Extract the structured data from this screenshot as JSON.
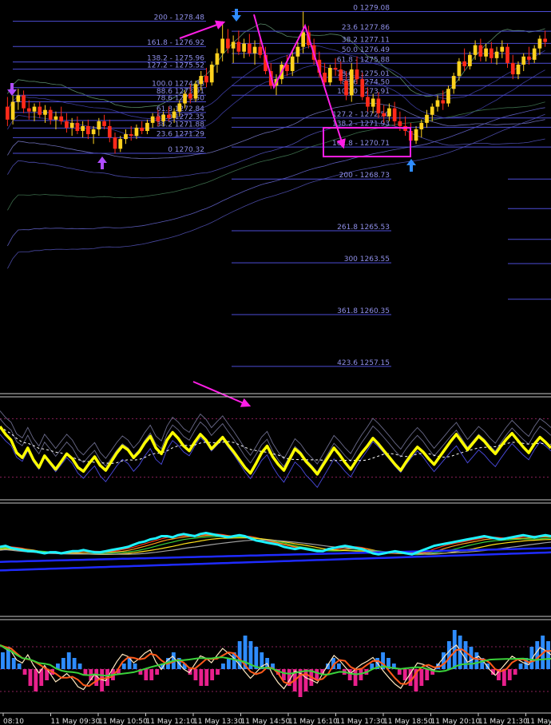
{
  "colors": {
    "background": "#000000",
    "bull": "#ffd21e",
    "bear": "#ff2a1a",
    "fib_line": "#4d4dd6",
    "fib_text": "#8f8fe8",
    "annotation": "#ff1ee6",
    "blue_arrow": "#2f8cff",
    "purple_arrow": "#b04cff",
    "oscillator": "#ffff00",
    "cyan_line": "#1ef2ff",
    "blue_ma": "#1f2bff",
    "hist_up": "#2e8cff",
    "hist_down": "#e8208c",
    "separator": "#c8c8c8",
    "axis_text": "#e0e0e0"
  },
  "chart_data": [
    {
      "type": "candlestick",
      "panel": "price",
      "fib_levels_left": [
        {
          "label": "200 - 1278.48"
        },
        {
          "label": "161.8 - 1276.92"
        },
        {
          "label": "138.2 - 1275.96"
        },
        {
          "label": "127.2 - 1275.52"
        },
        {
          "label": "100.0 1274.38"
        },
        {
          "label": "88.6 1273.91"
        },
        {
          "label": "78.6 1273.50"
        },
        {
          "label": "61.8 1272.84"
        },
        {
          "label": "50.0 1272.35"
        },
        {
          "label": "38.2 1271.88"
        },
        {
          "label": "23.6 1271.29"
        },
        {
          "label": "0 1270.32"
        }
      ],
      "fib_levels_right": [
        {
          "label": "0 1279.08"
        },
        {
          "label": "23.6 1277.86"
        },
        {
          "label": "38.2 1277.11"
        },
        {
          "label": "50.0 1276.49"
        },
        {
          "label": "61.8 - 1275.88"
        },
        {
          "label": "78.6 - 1275.01"
        },
        {
          "label": "88.6 1274.50"
        },
        {
          "label": "100.0 1273.91"
        },
        {
          "label": "127.2 - 1272.50"
        },
        {
          "label": "138.2 - 1271.93"
        },
        {
          "label": "161.8 - 1270.71"
        }
      ],
      "fib_extensions": [
        {
          "label": "200 - 1268.73"
        },
        {
          "label": "261.8 1265.53"
        },
        {
          "label": "300 1263.55"
        },
        {
          "label": "361.8 1260.35"
        },
        {
          "label": "423.6 1257.15"
        }
      ],
      "ohlc": [
        {
          "o": 1273.2,
          "h": 1273.8,
          "l": 1272.0,
          "c": 1272.4
        },
        {
          "o": 1272.4,
          "h": 1273.9,
          "l": 1272.1,
          "c": 1273.5
        },
        {
          "o": 1273.5,
          "h": 1274.3,
          "l": 1273.0,
          "c": 1273.9
        },
        {
          "o": 1273.9,
          "h": 1274.2,
          "l": 1272.8,
          "c": 1273.1
        },
        {
          "o": 1273.1,
          "h": 1273.6,
          "l": 1272.4,
          "c": 1272.9
        },
        {
          "o": 1272.9,
          "h": 1273.4,
          "l": 1272.3,
          "c": 1273.2
        },
        {
          "o": 1273.2,
          "h": 1273.5,
          "l": 1272.5,
          "c": 1272.7
        },
        {
          "o": 1272.7,
          "h": 1273.3,
          "l": 1272.2,
          "c": 1273.0
        },
        {
          "o": 1273.0,
          "h": 1273.2,
          "l": 1272.1,
          "c": 1272.4
        },
        {
          "o": 1272.4,
          "h": 1272.9,
          "l": 1271.8,
          "c": 1272.6
        },
        {
          "o": 1272.6,
          "h": 1273.2,
          "l": 1272.1,
          "c": 1272.3
        },
        {
          "o": 1272.3,
          "h": 1272.8,
          "l": 1271.6,
          "c": 1271.9
        },
        {
          "o": 1271.9,
          "h": 1272.5,
          "l": 1271.4,
          "c": 1272.2
        },
        {
          "o": 1272.2,
          "h": 1272.6,
          "l": 1271.5,
          "c": 1271.7
        },
        {
          "o": 1271.7,
          "h": 1272.3,
          "l": 1271.3,
          "c": 1272.0
        },
        {
          "o": 1272.0,
          "h": 1272.4,
          "l": 1271.2,
          "c": 1271.5
        },
        {
          "o": 1271.5,
          "h": 1272.0,
          "l": 1270.9,
          "c": 1271.8
        },
        {
          "o": 1271.8,
          "h": 1272.5,
          "l": 1271.4,
          "c": 1272.3
        },
        {
          "o": 1272.3,
          "h": 1272.7,
          "l": 1271.8,
          "c": 1272.0
        },
        {
          "o": 1272.0,
          "h": 1272.4,
          "l": 1271.0,
          "c": 1271.3
        },
        {
          "o": 1271.3,
          "h": 1271.6,
          "l": 1270.3,
          "c": 1270.6
        },
        {
          "o": 1270.6,
          "h": 1271.4,
          "l": 1270.4,
          "c": 1271.2
        },
        {
          "o": 1271.2,
          "h": 1271.8,
          "l": 1270.9,
          "c": 1271.5
        },
        {
          "o": 1271.5,
          "h": 1272.0,
          "l": 1271.1,
          "c": 1271.4
        },
        {
          "o": 1271.4,
          "h": 1272.1,
          "l": 1271.2,
          "c": 1271.9
        },
        {
          "o": 1271.9,
          "h": 1272.3,
          "l": 1271.5,
          "c": 1271.7
        },
        {
          "o": 1271.7,
          "h": 1272.4,
          "l": 1271.5,
          "c": 1272.2
        },
        {
          "o": 1272.2,
          "h": 1272.8,
          "l": 1271.9,
          "c": 1272.6
        },
        {
          "o": 1272.6,
          "h": 1273.0,
          "l": 1272.0,
          "c": 1272.3
        },
        {
          "o": 1272.3,
          "h": 1272.9,
          "l": 1272.0,
          "c": 1272.7
        },
        {
          "o": 1272.7,
          "h": 1273.2,
          "l": 1272.3,
          "c": 1272.5
        },
        {
          "o": 1272.5,
          "h": 1273.1,
          "l": 1272.2,
          "c": 1272.9
        },
        {
          "o": 1272.9,
          "h": 1273.6,
          "l": 1272.6,
          "c": 1273.4
        },
        {
          "o": 1273.4,
          "h": 1274.2,
          "l": 1273.1,
          "c": 1274.0
        },
        {
          "o": 1274.0,
          "h": 1274.6,
          "l": 1273.4,
          "c": 1273.7
        },
        {
          "o": 1273.7,
          "h": 1274.8,
          "l": 1273.5,
          "c": 1274.6
        },
        {
          "o": 1274.6,
          "h": 1275.4,
          "l": 1274.2,
          "c": 1275.1
        },
        {
          "o": 1275.1,
          "h": 1275.6,
          "l": 1274.4,
          "c": 1274.7
        },
        {
          "o": 1274.7,
          "h": 1276.0,
          "l": 1274.5,
          "c": 1275.8
        },
        {
          "o": 1275.8,
          "h": 1276.8,
          "l": 1275.3,
          "c": 1276.5
        },
        {
          "o": 1276.5,
          "h": 1278.48,
          "l": 1276.0,
          "c": 1277.4
        },
        {
          "o": 1277.4,
          "h": 1278.0,
          "l": 1276.5,
          "c": 1276.8
        },
        {
          "o": 1276.8,
          "h": 1277.6,
          "l": 1275.9,
          "c": 1277.2
        },
        {
          "o": 1277.2,
          "h": 1277.9,
          "l": 1276.4,
          "c": 1276.6
        },
        {
          "o": 1276.6,
          "h": 1277.4,
          "l": 1276.2,
          "c": 1277.1
        },
        {
          "o": 1277.1,
          "h": 1277.7,
          "l": 1276.3,
          "c": 1276.5
        },
        {
          "o": 1276.5,
          "h": 1277.3,
          "l": 1275.8,
          "c": 1276.9
        },
        {
          "o": 1276.9,
          "h": 1277.5,
          "l": 1276.2,
          "c": 1276.4
        },
        {
          "o": 1276.4,
          "h": 1276.9,
          "l": 1275.2,
          "c": 1275.4
        },
        {
          "o": 1275.4,
          "h": 1275.9,
          "l": 1274.3,
          "c": 1274.5
        },
        {
          "o": 1274.5,
          "h": 1275.2,
          "l": 1273.91,
          "c": 1274.9
        },
        {
          "o": 1274.9,
          "h": 1276.0,
          "l": 1274.6,
          "c": 1275.8
        },
        {
          "o": 1275.8,
          "h": 1276.4,
          "l": 1275.1,
          "c": 1275.4
        },
        {
          "o": 1275.4,
          "h": 1276.6,
          "l": 1275.1,
          "c": 1276.3
        },
        {
          "o": 1276.3,
          "h": 1277.2,
          "l": 1275.9,
          "c": 1276.9
        },
        {
          "o": 1276.9,
          "h": 1279.08,
          "l": 1276.5,
          "c": 1277.8
        },
        {
          "o": 1277.8,
          "h": 1278.2,
          "l": 1276.8,
          "c": 1277.0
        },
        {
          "o": 1277.0,
          "h": 1277.4,
          "l": 1275.8,
          "c": 1276.1
        },
        {
          "o": 1276.1,
          "h": 1276.6,
          "l": 1275.0,
          "c": 1275.3
        },
        {
          "o": 1275.3,
          "h": 1275.9,
          "l": 1274.4,
          "c": 1274.7
        },
        {
          "o": 1274.7,
          "h": 1275.8,
          "l": 1274.5,
          "c": 1275.6
        },
        {
          "o": 1275.6,
          "h": 1276.2,
          "l": 1275.1,
          "c": 1275.5
        },
        {
          "o": 1275.5,
          "h": 1276.0,
          "l": 1274.6,
          "c": 1274.8
        },
        {
          "o": 1274.8,
          "h": 1275.4,
          "l": 1273.6,
          "c": 1273.9
        },
        {
          "o": 1273.9,
          "h": 1275.9,
          "l": 1273.5,
          "c": 1275.5
        },
        {
          "o": 1275.5,
          "h": 1276.3,
          "l": 1274.6,
          "c": 1274.9
        },
        {
          "o": 1274.9,
          "h": 1275.3,
          "l": 1273.6,
          "c": 1273.8
        },
        {
          "o": 1273.8,
          "h": 1274.4,
          "l": 1272.9,
          "c": 1273.2
        },
        {
          "o": 1273.2,
          "h": 1274.0,
          "l": 1272.8,
          "c": 1273.7
        },
        {
          "o": 1273.7,
          "h": 1274.1,
          "l": 1272.5,
          "c": 1272.8
        },
        {
          "o": 1272.8,
          "h": 1273.3,
          "l": 1272.2,
          "c": 1272.6
        },
        {
          "o": 1272.6,
          "h": 1273.4,
          "l": 1272.3,
          "c": 1273.1
        },
        {
          "o": 1273.1,
          "h": 1273.5,
          "l": 1272.0,
          "c": 1272.3
        },
        {
          "o": 1272.3,
          "h": 1272.9,
          "l": 1271.7,
          "c": 1272.0
        },
        {
          "o": 1272.0,
          "h": 1272.6,
          "l": 1271.4,
          "c": 1271.7
        },
        {
          "o": 1271.7,
          "h": 1272.2,
          "l": 1270.71,
          "c": 1271.1
        },
        {
          "o": 1271.1,
          "h": 1272.0,
          "l": 1270.9,
          "c": 1271.8
        },
        {
          "o": 1271.8,
          "h": 1272.4,
          "l": 1271.3,
          "c": 1272.2
        },
        {
          "o": 1272.2,
          "h": 1273.0,
          "l": 1271.9,
          "c": 1272.7
        },
        {
          "o": 1272.7,
          "h": 1273.4,
          "l": 1272.3,
          "c": 1273.2
        },
        {
          "o": 1273.2,
          "h": 1273.9,
          "l": 1272.9,
          "c": 1273.6
        },
        {
          "o": 1273.6,
          "h": 1274.2,
          "l": 1273.0,
          "c": 1273.4
        },
        {
          "o": 1273.4,
          "h": 1274.5,
          "l": 1273.2,
          "c": 1274.3
        },
        {
          "o": 1274.3,
          "h": 1275.3,
          "l": 1274.0,
          "c": 1275.1
        },
        {
          "o": 1275.1,
          "h": 1276.2,
          "l": 1274.8,
          "c": 1276.0
        },
        {
          "o": 1276.0,
          "h": 1276.8,
          "l": 1275.4,
          "c": 1275.7
        },
        {
          "o": 1275.7,
          "h": 1276.6,
          "l": 1275.5,
          "c": 1276.4
        },
        {
          "o": 1276.4,
          "h": 1277.3,
          "l": 1276.1,
          "c": 1277.0
        },
        {
          "o": 1277.0,
          "h": 1277.4,
          "l": 1276.0,
          "c": 1276.3
        },
        {
          "o": 1276.3,
          "h": 1277.1,
          "l": 1276.0,
          "c": 1276.8
        },
        {
          "o": 1276.8,
          "h": 1277.2,
          "l": 1275.9,
          "c": 1276.2
        },
        {
          "o": 1276.2,
          "h": 1276.9,
          "l": 1275.8,
          "c": 1276.6
        },
        {
          "o": 1276.6,
          "h": 1277.3,
          "l": 1276.2,
          "c": 1276.9
        },
        {
          "o": 1276.9,
          "h": 1277.1,
          "l": 1275.6,
          "c": 1275.9
        },
        {
          "o": 1275.9,
          "h": 1276.4,
          "l": 1274.9,
          "c": 1275.2
        },
        {
          "o": 1275.2,
          "h": 1276.0,
          "l": 1274.9,
          "c": 1275.8
        },
        {
          "o": 1275.8,
          "h": 1276.5,
          "l": 1275.4,
          "c": 1276.3
        },
        {
          "o": 1276.3,
          "h": 1276.9,
          "l": 1275.8,
          "c": 1276.1
        },
        {
          "o": 1276.1,
          "h": 1277.0,
          "l": 1275.9,
          "c": 1276.8
        },
        {
          "o": 1276.8,
          "h": 1277.6,
          "l": 1276.4,
          "c": 1277.4
        },
        {
          "o": 1277.4,
          "h": 1277.9,
          "l": 1276.9,
          "c": 1277.2
        }
      ]
    },
    {
      "type": "line",
      "panel": "oscillator",
      "series_values": [
        72,
        64,
        58,
        45,
        40,
        50,
        38,
        30,
        42,
        35,
        28,
        36,
        44,
        39,
        30,
        26,
        34,
        41,
        32,
        27,
        36,
        45,
        52,
        48,
        40,
        46,
        55,
        62,
        50,
        44,
        58,
        66,
        60,
        52,
        47,
        56,
        64,
        58,
        49,
        55,
        61,
        53,
        46,
        38,
        30,
        24,
        34,
        45,
        52,
        41,
        33,
        27,
        38,
        49,
        44,
        36,
        30,
        23,
        32,
        41,
        50,
        43,
        35,
        28,
        37,
        45,
        52,
        60,
        54,
        47,
        40,
        33,
        27,
        36,
        44,
        51,
        46,
        39,
        33,
        41,
        49,
        57,
        64,
        56,
        48,
        55,
        62,
        57,
        50,
        44,
        52,
        59,
        65,
        58,
        51,
        45,
        54,
        61,
        56,
        50
      ]
    },
    {
      "type": "line",
      "panel": "moving-averages",
      "series_values": [
        62,
        63,
        61,
        60,
        59,
        58,
        58,
        57,
        56,
        57,
        57,
        56,
        57,
        58,
        58,
        59,
        58,
        57,
        57,
        58,
        59,
        60,
        61,
        62,
        64,
        66,
        67,
        69,
        70,
        72,
        72,
        71,
        73,
        74,
        73,
        72,
        74,
        75,
        74,
        73,
        72,
        71,
        72,
        73,
        72,
        70,
        68,
        67,
        66,
        65,
        64,
        62,
        61,
        60,
        61,
        60,
        59,
        58,
        58,
        60,
        61,
        62,
        63,
        62,
        61,
        60,
        58,
        56,
        55,
        56,
        57,
        58,
        57,
        56,
        55,
        57,
        59,
        61,
        63,
        64,
        65,
        66,
        67,
        68,
        69,
        70,
        71,
        72,
        71,
        70,
        69,
        70,
        71,
        72,
        73,
        72,
        71,
        72,
        73,
        72
      ]
    },
    {
      "type": "bar",
      "panel": "histogram",
      "values": [
        3,
        4,
        2,
        1,
        -1,
        -3,
        -4,
        -3,
        -2,
        -1,
        1,
        2,
        3,
        2,
        1,
        -1,
        -2,
        -3,
        -4,
        -3,
        -2,
        -1,
        1,
        2,
        1,
        -1,
        -2,
        -2,
        -1,
        1,
        2,
        3,
        2,
        1,
        -1,
        -2,
        -3,
        -3,
        -2,
        -1,
        1,
        2,
        3,
        5,
        6,
        5,
        4,
        3,
        2,
        1,
        -1,
        -2,
        -3,
        -4,
        -5,
        -4,
        -3,
        -2,
        -1,
        1,
        2,
        1,
        -1,
        -2,
        -3,
        -2,
        -1,
        1,
        2,
        3,
        2,
        1,
        -1,
        -2,
        -3,
        -4,
        -3,
        -2,
        -1,
        1,
        3,
        5,
        7,
        6,
        5,
        4,
        3,
        2,
        1,
        -1,
        -2,
        -3,
        -2,
        -1,
        1,
        2,
        4,
        5,
        6,
        5
      ]
    }
  ],
  "time_labels": [
    "08:10",
    "11 May 09:30",
    "11 May 10:50",
    "11 May 12:10",
    "11 May 13:30",
    "11 May 14:50",
    "11 May 16:10",
    "11 May 17:30",
    "11 May 18:50",
    "11 May 20:10",
    "11 May 21:30",
    "11 May"
  ]
}
